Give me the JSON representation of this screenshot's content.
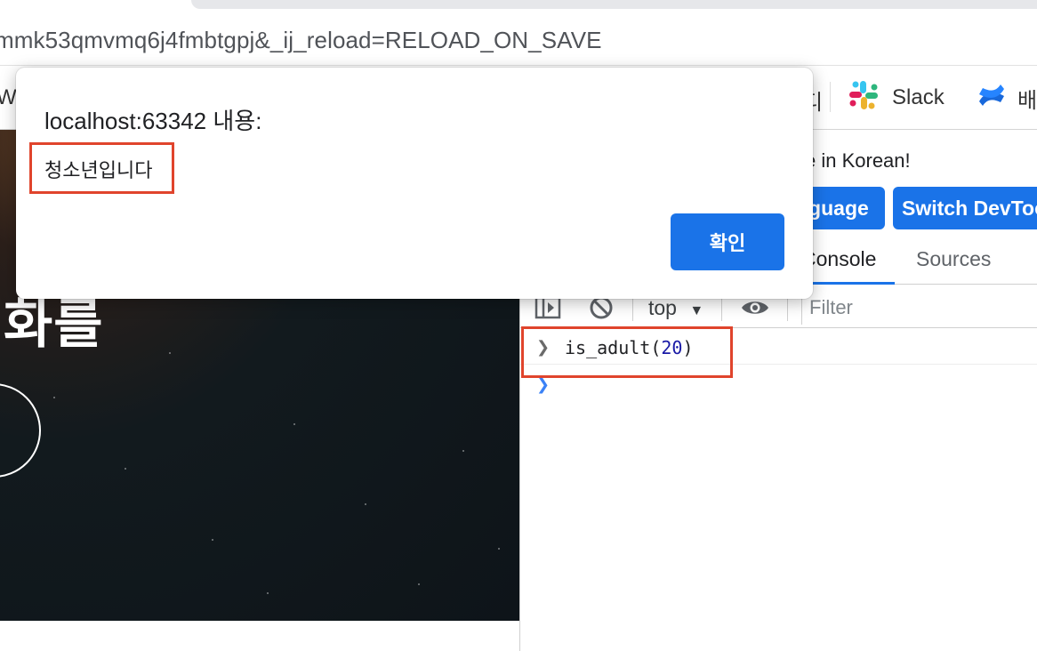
{
  "browser": {
    "url_visible": "mmk53qmvmq6j4fmbtgpj&_ij_reload=RELOAD_ON_SAVE",
    "bookmarks": {
      "left_partial": "Wi",
      "partial_item": "디",
      "slack_label": "Slack",
      "confluence_partial": "배"
    }
  },
  "page": {
    "hero_title_partial": "화를"
  },
  "devtools": {
    "language_message": "e in Korean!",
    "language_button": "nguage",
    "switch_button": "Switch DevTools",
    "tabs": {
      "console": "Console",
      "sources": "Sources"
    },
    "context": "top",
    "filter_placeholder": "Filter",
    "console_input": {
      "fn": "is_adult(",
      "arg": "20",
      "close": ")"
    }
  },
  "dialog": {
    "title": "localhost:63342 내용:",
    "message": "청소년입니다",
    "ok_label": "확인"
  },
  "colors": {
    "accent": "#1a73e8",
    "highlight": "#e0442c"
  }
}
